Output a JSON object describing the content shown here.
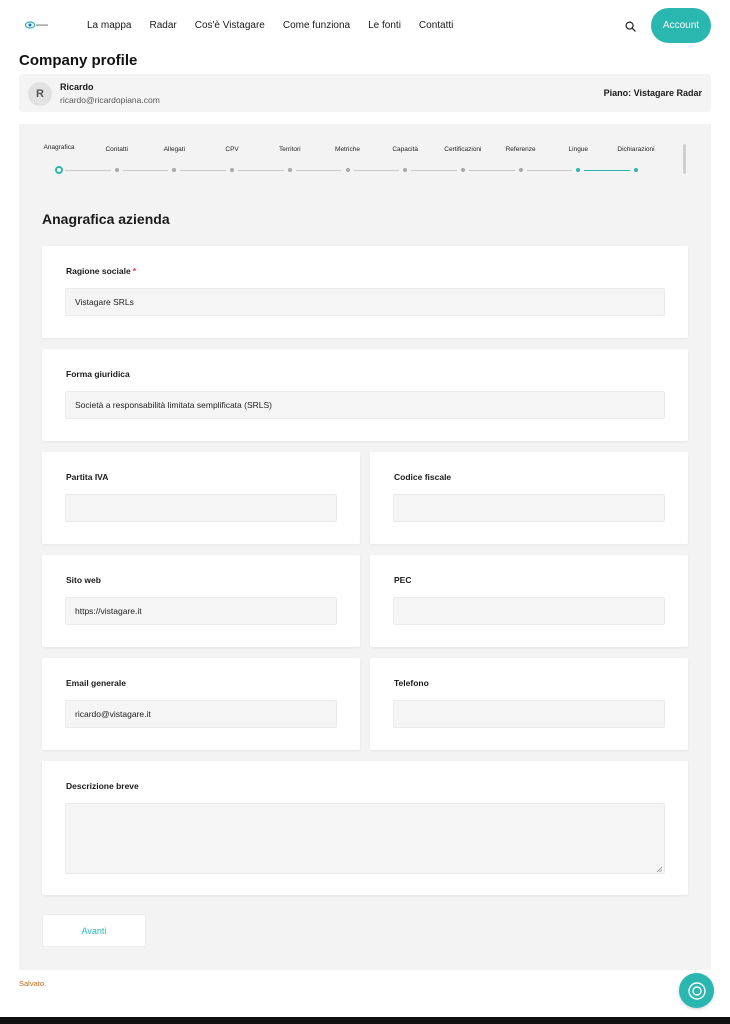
{
  "header": {
    "nav": [
      "La mappa",
      "Radar",
      "Cos'è Vistagare",
      "Come funziona",
      "Le fonti",
      "Contatti"
    ],
    "account_label": "Account",
    "brand_color": "#2ab7b0"
  },
  "page_title": "Company profile",
  "user": {
    "initial": "R",
    "name": "Ricardo",
    "email": "ricardo@ricardopiana.com",
    "plan": "Piano: Vistagare Radar"
  },
  "stepper": {
    "steps": [
      "Anagrafica",
      "Contatti",
      "Allegati",
      "CPV",
      "Territori",
      "Metriche",
      "Capacità",
      "Certificazioni",
      "Referenze",
      "Lingue",
      "Dichiarazioni"
    ],
    "current_index": 0
  },
  "section_title": "Anagrafica azienda",
  "fields": {
    "ragione_sociale": {
      "label": "Ragione sociale",
      "required_mark": "*",
      "value": "Vistagare SRLs"
    },
    "forma_giuridica": {
      "label": "Forma giuridica",
      "value": "Società a responsabilità limitata semplificata (SRLS)"
    },
    "partita_iva": {
      "label": "Partita IVA",
      "value": ""
    },
    "codice_fiscale": {
      "label": "Codice fiscale",
      "value": ""
    },
    "sito_web": {
      "label": "Sito web",
      "value": "https://vistagare.it"
    },
    "pec": {
      "label": "PEC",
      "value": ""
    },
    "email_generale": {
      "label": "Email generale",
      "value": "ricardo@vistagare.it"
    },
    "telefono": {
      "label": "Telefono",
      "value": ""
    },
    "descrizione_breve": {
      "label": "Descrizione breve",
      "value": ""
    }
  },
  "next_label": "Avanti",
  "status": "Salvato."
}
